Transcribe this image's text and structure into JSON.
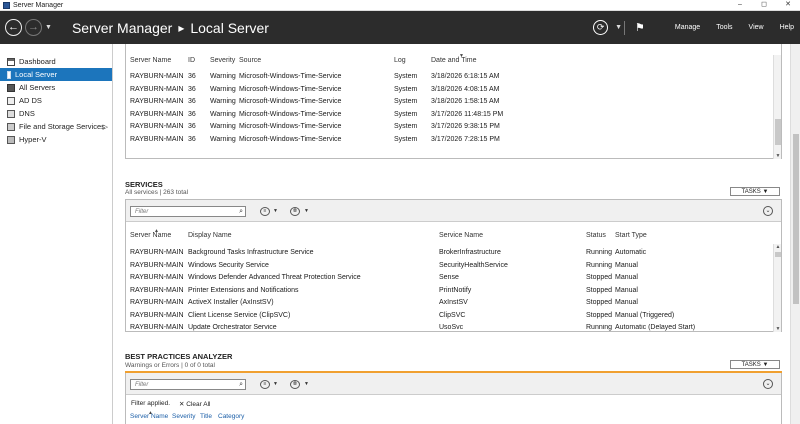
{
  "window": {
    "title": "Server Manager",
    "controls": [
      "–",
      "◻",
      "✕"
    ]
  },
  "header": {
    "app": "Server Manager",
    "separator": "▸",
    "location": "Local Server",
    "menu": [
      "Manage",
      "Tools",
      "View",
      "Help"
    ]
  },
  "sidebar": {
    "items": [
      {
        "label": "Dashboard",
        "icon": "dashboard-icon"
      },
      {
        "label": "Local Server",
        "icon": "local-server-icon",
        "active": true
      },
      {
        "label": "All Servers",
        "icon": "all-servers-icon"
      },
      {
        "label": "AD DS",
        "icon": "ad-ds-icon"
      },
      {
        "label": "DNS",
        "icon": "dns-icon"
      },
      {
        "label": "File and Storage Services",
        "icon": "file-storage-icon",
        "chevron": "▷"
      },
      {
        "label": "Hyper-V",
        "icon": "hyper-v-icon"
      }
    ]
  },
  "events": {
    "columns": [
      "Server Name",
      "ID",
      "Severity",
      "Source",
      "Log",
      "Date and Time"
    ],
    "rows": [
      [
        "RAYBURN-MAIN",
        "36",
        "Warning",
        "Microsoft-Windows-Time-Service",
        "System",
        "3/18/2026 6:18:15 AM"
      ],
      [
        "RAYBURN-MAIN",
        "36",
        "Warning",
        "Microsoft-Windows-Time-Service",
        "System",
        "3/18/2026 4:08:15 AM"
      ],
      [
        "RAYBURN-MAIN",
        "36",
        "Warning",
        "Microsoft-Windows-Time-Service",
        "System",
        "3/18/2026 1:58:15 AM"
      ],
      [
        "RAYBURN-MAIN",
        "36",
        "Warning",
        "Microsoft-Windows-Time-Service",
        "System",
        "3/17/2026 11:48:15 PM"
      ],
      [
        "RAYBURN-MAIN",
        "36",
        "Warning",
        "Microsoft-Windows-Time-Service",
        "System",
        "3/17/2026 9:38:15 PM"
      ],
      [
        "RAYBURN-MAIN",
        "36",
        "Warning",
        "Microsoft-Windows-Time-Service",
        "System",
        "3/17/2026 7:28:15 PM"
      ]
    ]
  },
  "services": {
    "title": "SERVICES",
    "subtitle": "All services | 263 total",
    "tasks": "TASKS",
    "filter_placeholder": "Filter",
    "columns": [
      "Server Name",
      "Display Name",
      "Service Name",
      "Status",
      "Start Type"
    ],
    "rows": [
      [
        "RAYBURN-MAIN",
        "Background Tasks Infrastructure Service",
        "BrokerInfrastructure",
        "Running",
        "Automatic"
      ],
      [
        "RAYBURN-MAIN",
        "Windows Security Service",
        "SecurityHealthService",
        "Running",
        "Manual"
      ],
      [
        "RAYBURN-MAIN",
        "Windows Defender Advanced Threat Protection Service",
        "Sense",
        "Stopped",
        "Manual"
      ],
      [
        "RAYBURN-MAIN",
        "Printer Extensions and Notifications",
        "PrintNotify",
        "Stopped",
        "Manual"
      ],
      [
        "RAYBURN-MAIN",
        "ActiveX Installer (AxInstSV)",
        "AxInstSV",
        "Stopped",
        "Manual"
      ],
      [
        "RAYBURN-MAIN",
        "Client License Service (ClipSVC)",
        "ClipSVC",
        "Stopped",
        "Manual (Triggered)"
      ],
      [
        "RAYBURN-MAIN",
        "Update Orchestrator Service",
        "UsoSvc",
        "Running",
        "Automatic (Delayed Start)"
      ]
    ]
  },
  "bpa": {
    "title": "BEST PRACTICES ANALYZER",
    "subtitle": "Warnings or Errors | 0 of 0 total",
    "tasks": "TASKS",
    "filter_placeholder": "Filter",
    "filter_applied": "Filter applied.",
    "clear_all": "✕  Clear All",
    "columns": [
      "Server Name",
      "Severity",
      "Title",
      "Category"
    ]
  },
  "colors": {
    "header_bg": "#2c2c2c",
    "active_item": "#1c75bc",
    "bpa_accent": "#f0a030"
  }
}
